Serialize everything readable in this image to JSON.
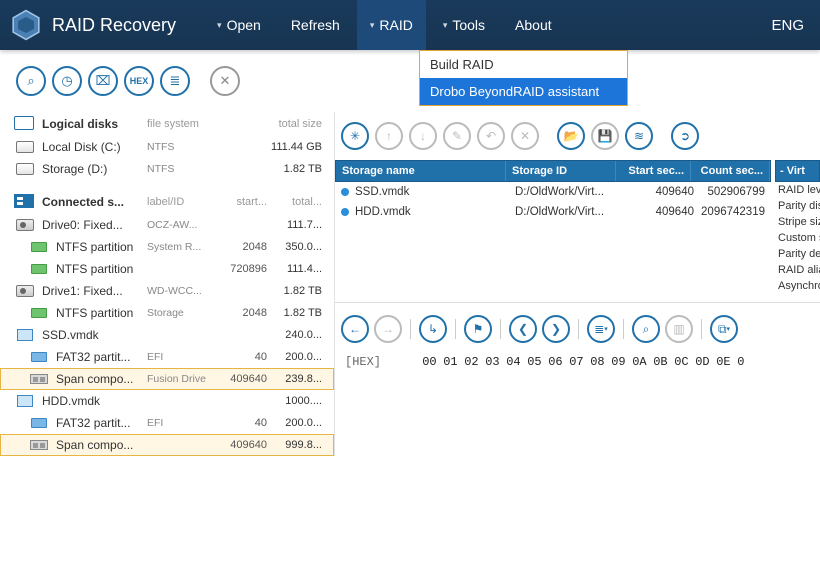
{
  "app": {
    "title": "RAID Recovery",
    "lang": "ENG"
  },
  "menu": {
    "open": "Open",
    "refresh": "Refresh",
    "raid": "RAID",
    "tools": "Tools",
    "about": "About",
    "dropdown": {
      "item0": "Build RAID",
      "item1": "Drobo BeyondRAID assistant"
    }
  },
  "toolbar": {
    "btn0": "⌕",
    "btn1": "◷",
    "btn2": "⌧",
    "btn3": "HEX",
    "btn4": "≣",
    "btn5": "✕"
  },
  "sections": {
    "logical": {
      "title": "Logical disks",
      "col1": "file system",
      "col3": "total size"
    },
    "connected": {
      "title": "Connected s...",
      "col1": "label/ID",
      "col2": "start...",
      "col3": "total..."
    }
  },
  "logical_rows": [
    {
      "name": "Local Disk (C:)",
      "fs": "NTFS",
      "size": "111.44 GB"
    },
    {
      "name": "Storage (D:)",
      "fs": "NTFS",
      "size": "1.82 TB"
    }
  ],
  "connected_rows": [
    {
      "type": "drive",
      "name": "Drive0: Fixed...",
      "label": "OCZ-AW...",
      "start": "",
      "size": "111.7..."
    },
    {
      "type": "part-g",
      "name": "NTFS partition",
      "label": "System R...",
      "start": "2048",
      "size": "350.0..."
    },
    {
      "type": "part-g",
      "name": "NTFS partition",
      "label": "",
      "start": "720896",
      "size": "111.4..."
    },
    {
      "type": "drive",
      "name": "Drive1: Fixed...",
      "label": "WD-WCC...",
      "start": "",
      "size": "1.82 TB"
    },
    {
      "type": "part-g",
      "name": "NTFS partition",
      "label": "Storage",
      "start": "2048",
      "size": "1.82 TB"
    },
    {
      "type": "vmdk",
      "name": "SSD.vmdk",
      "label": "",
      "start": "",
      "size": "240.0..."
    },
    {
      "type": "part-b",
      "name": "FAT32 partit...",
      "label": "EFI",
      "start": "40",
      "size": "200.0..."
    },
    {
      "type": "span",
      "name": "Span compo...",
      "label": "Fusion Drive",
      "start": "409640",
      "size": "239.8...",
      "selected": true
    },
    {
      "type": "vmdk",
      "name": "HDD.vmdk",
      "label": "",
      "start": "",
      "size": "1000...."
    },
    {
      "type": "part-b",
      "name": "FAT32 partit...",
      "label": "EFI",
      "start": "40",
      "size": "200.0..."
    },
    {
      "type": "span",
      "name": "Span compo...",
      "label": "",
      "start": "409640",
      "size": "999.8...",
      "selected": true
    }
  ],
  "storage_table": {
    "headers": {
      "h1": "Storage name",
      "h2": "Storage ID",
      "h3": "Start sec...",
      "h4": "Count sec..."
    },
    "rows": [
      {
        "name": "SSD.vmdk",
        "id": "D:/OldWork/Virt...",
        "start": "409640",
        "count": "502906799"
      },
      {
        "name": "HDD.vmdk",
        "id": "D:/OldWork/Virt...",
        "start": "409640",
        "count": "2096742319"
      }
    ]
  },
  "props_side": {
    "header": "-    Virt",
    "rows": [
      "RAID lev",
      "Parity dis",
      "Stripe siz",
      "Custom s",
      "Parity de",
      "RAID alia",
      "Asynchro"
    ]
  },
  "hex": {
    "label": "[HEX]",
    "bytes": [
      "00",
      "01",
      "02",
      "03",
      "04",
      "05",
      "06",
      "07",
      "08",
      "09",
      "0A",
      "0B",
      "0C",
      "0D",
      "0E",
      "0"
    ]
  }
}
